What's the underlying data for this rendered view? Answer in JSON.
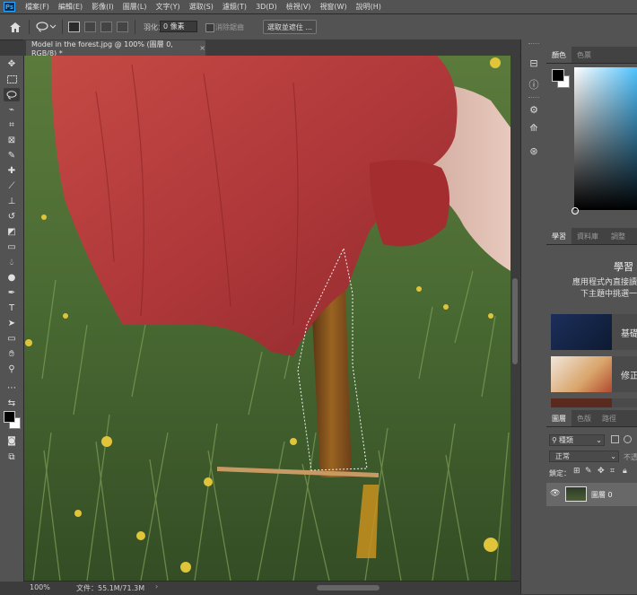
{
  "app": {
    "logo": "Ps"
  },
  "menu": [
    "檔案(F)",
    "編輯(E)",
    "影像(I)",
    "圖層(L)",
    "文字(Y)",
    "選取(S)",
    "濾鏡(T)",
    "3D(D)",
    "檢視(V)",
    "視窗(W)",
    "說明(H)"
  ],
  "options_bar": {
    "feather_label": "羽化：",
    "feather_value": "0 像素",
    "anti_alias_label": "消除鋸齒",
    "select_mask_label": "選取並遮住 ..."
  },
  "document": {
    "tab_title": "Model in the forest.jpg @ 100% (圖層 0, RGB/8) *",
    "close_glyph": "×"
  },
  "status": {
    "zoom": "100%",
    "doc_size": "文件：55.1M/71.3M",
    "arrow": "›"
  },
  "panels": {
    "color_tabs": [
      "顏色",
      "色票"
    ],
    "learn_tabs": [
      "學習",
      "資料庫",
      "調整"
    ],
    "learn": {
      "title": "學習",
      "desc_line1": "應用程式內直接讀",
      "desc_line2": "下主題中挑選一",
      "cards": [
        "基礎",
        "修正"
      ]
    },
    "layers_tabs": [
      "圖層",
      "色版",
      "路徑"
    ],
    "layers": {
      "kind_filter": "種類",
      "blend_mode": "正常",
      "opacity_label": "不透",
      "lock_label": "鎖定：",
      "layer_name": "圖層 0"
    }
  },
  "colors": {
    "menu_bg": "#535353",
    "app_bg": "#3c3c3c",
    "dress_red": "#b53a37",
    "grass_green": "#4e6b35",
    "accent_blue": "#31a8ff"
  },
  "icons": {
    "home": "home-icon",
    "lasso": "lasso-icon",
    "move": "move-icon",
    "hand": "hand-icon",
    "zoom": "zoom-icon",
    "eye": "eye-icon"
  }
}
